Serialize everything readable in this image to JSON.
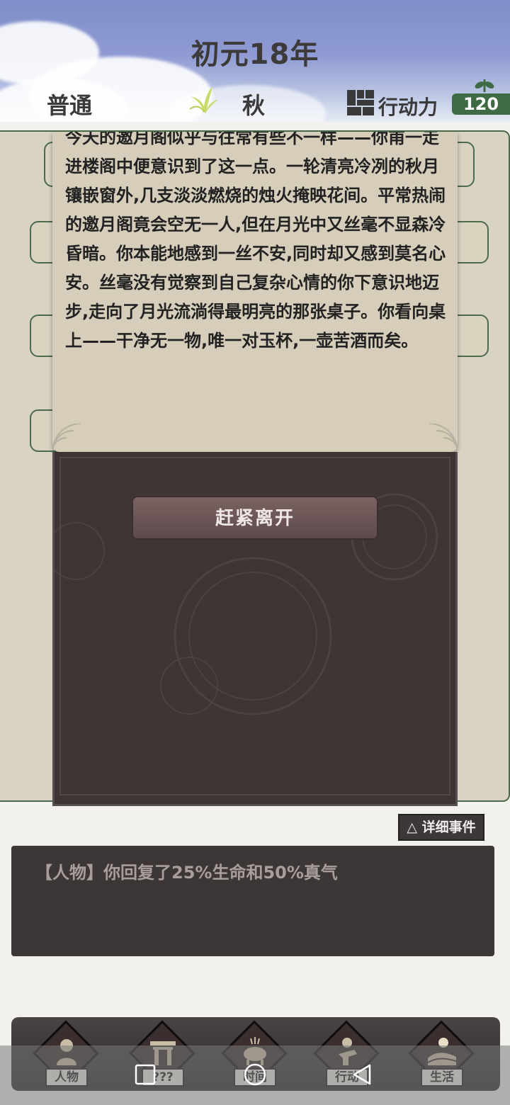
{
  "header": {
    "year": "初元18年",
    "mode": "普通",
    "season": "秋",
    "action_label": "行动力",
    "action_points": "120"
  },
  "event": {
    "text": "今天的邀月阁似乎与往常有些不一样——你甫一走进楼阁中便意识到了这一点。一轮清亮冷冽的秋月镶嵌窗外,几支淡淡燃烧的烛火掩映花间。平常热闹的邀月阁竟会空无一人,但在月光中又丝毫不显森冷昏暗。你本能地感到一丝不安,同时却又感到莫名心安。丝毫没有觉察到自己复杂心情的你下意识地迈步,走向了月光流淌得最明亮的那张桌子。你看向桌上——干净无一物,唯一对玉杯,一壶苦酒而矣。",
    "leave_button": "赶紧离开"
  },
  "detail_button": "△ 详细事件",
  "log": {
    "entry": "【人物】你回复了25%生命和50%真气"
  },
  "nav": {
    "items": [
      {
        "label": "人物",
        "icon": "person-icon"
      },
      {
        "label": "???",
        "icon": "gate-icon"
      },
      {
        "label": "时间",
        "icon": "incense-burner-icon"
      },
      {
        "label": "行动",
        "icon": "action-icon"
      },
      {
        "label": "生活",
        "icon": "landscape-icon"
      }
    ]
  },
  "colors": {
    "accent_green": "#3f6b44",
    "dialog_dark": "#3f3535",
    "dialog_light": "#d6ceba"
  }
}
